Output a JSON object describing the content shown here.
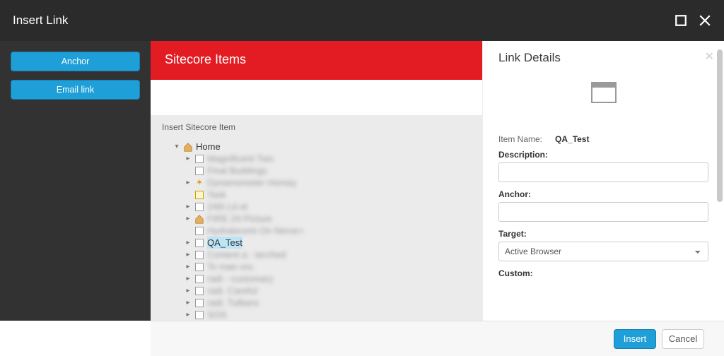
{
  "dialog": {
    "title": "Insert Link"
  },
  "sidebar": {
    "anchor_label": "Anchor",
    "email_label": "Email link"
  },
  "mid": {
    "header": "Sitecore Items",
    "insert_label": "Insert Sitecore Item",
    "tree": {
      "root": {
        "label": "Home",
        "expanded": true
      },
      "children": [
        {
          "label": "Magnificent Two",
          "icon": "page",
          "expand": true,
          "blur": true
        },
        {
          "label": "Final Buildings",
          "icon": "page",
          "expand": false,
          "blur": true
        },
        {
          "label": "Dynamometer Homey",
          "icon": "spark",
          "expand": true,
          "blur": true
        },
        {
          "label": "Task",
          "icon": "pagey",
          "expand": false,
          "blur": true
        },
        {
          "label": "24th Lit et",
          "icon": "page",
          "expand": true,
          "blur": true
        },
        {
          "label": "FIRE 24 Picture",
          "icon": "home",
          "expand": true,
          "blur": true
        },
        {
          "label": "Hydratecent On Nerve+",
          "icon": "page",
          "expand": false,
          "blur": true
        },
        {
          "label": "QA_Test",
          "icon": "page",
          "expand": true,
          "blur": false,
          "selected": true
        },
        {
          "label": "Content a - terched",
          "icon": "page",
          "expand": true,
          "blur": true
        },
        {
          "label": "To man ors.",
          "icon": "page",
          "expand": true,
          "blur": true
        },
        {
          "label": "radi - customary",
          "icon": "page",
          "expand": true,
          "blur": true
        },
        {
          "label": "radi. Careful",
          "icon": "page",
          "expand": true,
          "blur": true
        },
        {
          "label": "radi. Tullians",
          "icon": "page",
          "expand": true,
          "blur": true
        },
        {
          "label": "SOS",
          "icon": "page",
          "expand": true,
          "blur": true
        }
      ]
    }
  },
  "details": {
    "title": "Link Details",
    "item_name_label": "Item Name:",
    "item_name_value": "QA_Test",
    "description_label": "Description:",
    "description_value": "",
    "anchor_label": "Anchor:",
    "anchor_value": "",
    "target_label": "Target:",
    "target_value": "Active Browser",
    "custom_label": "Custom:"
  },
  "footer": {
    "insert_label": "Insert",
    "cancel_label": "Cancel"
  }
}
